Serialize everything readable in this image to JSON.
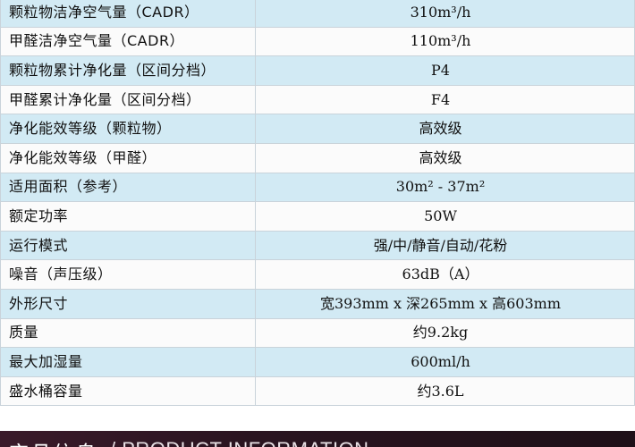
{
  "spec_table": {
    "rows": [
      {
        "label": "颗粒物洁净空气量（CADR）",
        "value": "310m³/h"
      },
      {
        "label": "甲醛洁净空气量（CADR）",
        "value": "110m³/h"
      },
      {
        "label": "颗粒物累计净化量（区间分档）",
        "value": "P4"
      },
      {
        "label": "甲醛累计净化量（区间分档）",
        "value": "F4"
      },
      {
        "label": "净化能效等级（颗粒物）",
        "value": "高效级"
      },
      {
        "label": "净化能效等级（甲醛）",
        "value": "高效级"
      },
      {
        "label": "适用面积（参考）",
        "value": "30m² - 37m²"
      },
      {
        "label": "额定功率",
        "value": "50W"
      },
      {
        "label": "运行模式",
        "value": "强/中/静音/自动/花粉"
      },
      {
        "label": "噪音（声压级）",
        "value": "63dB（A）"
      },
      {
        "label": "外形尺寸",
        "value": "宽393mm x 深265mm x 高603mm"
      },
      {
        "label": "质量",
        "value": "约9.2kg"
      },
      {
        "label": "最大加湿量",
        "value": "600ml/h"
      },
      {
        "label": "盛水桶容量",
        "value": "约3.6L"
      }
    ]
  },
  "section_header": {
    "title": "产品信息",
    "subtitle": "/ PRODUCT INFORMATION"
  }
}
